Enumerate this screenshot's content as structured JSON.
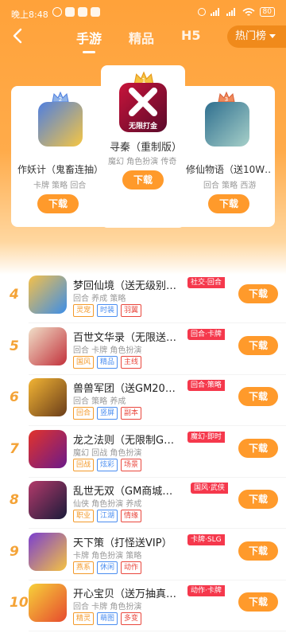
{
  "status_bar": {
    "time": "晚上8:48",
    "battery": "80"
  },
  "nav": {
    "tabs": [
      {
        "label": "手游",
        "active": true
      },
      {
        "label": "精品",
        "active": false
      },
      {
        "label": "H5",
        "active": false
      }
    ],
    "hot_button": "热门榜"
  },
  "podium": [
    {
      "rank": 2,
      "title": "作妖计（鬼畜连抽）",
      "tags": "卡牌 策略 回合",
      "button": "下载",
      "icon_colors": [
        "#4f7fe0",
        "#f6c642"
      ]
    },
    {
      "rank": 1,
      "title": "寻秦（重制版）",
      "tags": "魔幻 角色扮演 传奇",
      "button": "下载",
      "icon_label": "无限打金",
      "icon_colors": [
        "#c8143b",
        "#5a0a2a"
      ]
    },
    {
      "rank": 3,
      "title": "修仙物语（送10W…",
      "tags": "回合 策略 西游",
      "button": "下载",
      "icon_colors": [
        "#2f6f8f",
        "#a7d0c9"
      ]
    }
  ],
  "list": [
    {
      "rank": "4",
      "name": "梦回仙境（送无级别光…",
      "category": "社交·回合",
      "tags": "回合 养成 策略",
      "chips": [
        {
          "t": "灵宠",
          "c": "#f39a2b"
        },
        {
          "t": "时装",
          "c": "#4a8df0"
        },
        {
          "t": "羽翼",
          "c": "#e9473d"
        }
      ],
      "icon_colors": [
        "#f5c04a",
        "#3c8ee8"
      ]
    },
    {
      "rank": "5",
      "name": "百世文华录（无限送充…",
      "category": "回合·卡牌",
      "tags": "回合 卡牌 角色扮演",
      "chips": [
        {
          "t": "国风",
          "c": "#f39a2b"
        },
        {
          "t": "精品",
          "c": "#4a8df0"
        },
        {
          "t": "主线",
          "c": "#e9473d"
        }
      ],
      "icon_colors": [
        "#f0dfc8",
        "#c2313b"
      ]
    },
    {
      "rank": "6",
      "name": "兽兽军团（送GM20万…",
      "category": "回合·策略",
      "tags": "回合 策略 养成",
      "chips": [
        {
          "t": "回合",
          "c": "#f39a2b"
        },
        {
          "t": "竖屏",
          "c": "#4a8df0"
        },
        {
          "t": "副本",
          "c": "#e9473d"
        }
      ],
      "icon_colors": [
        "#f2b434",
        "#6a3d1a"
      ]
    },
    {
      "rank": "7",
      "name": "龙之法则（无限制GM…",
      "category": "魔幻·即时",
      "tags": "魔幻 回战 角色扮演",
      "chips": [
        {
          "t": "回战",
          "c": "#f39a2b"
        },
        {
          "t": "炫彩",
          "c": "#4a8df0"
        },
        {
          "t": "场景",
          "c": "#e9473d"
        }
      ],
      "icon_colors": [
        "#e2332b",
        "#6b1a8a"
      ]
    },
    {
      "rank": "8",
      "name": "乱世无双（GM商城版）",
      "category": "国风·武侠",
      "tags": "仙侠 角色扮演 养成",
      "chips": [
        {
          "t": "职业",
          "c": "#f39a2b"
        },
        {
          "t": "江湖",
          "c": "#4a8df0"
        },
        {
          "t": "情缘",
          "c": "#e9473d"
        }
      ],
      "icon_colors": [
        "#b23a6a",
        "#1b1b3a"
      ]
    },
    {
      "rank": "9",
      "name": "天下策（打怪送VIP）",
      "category": "卡牌·SLG",
      "tags": "卡牌 角色扮演 策略",
      "chips": [
        {
          "t": "燕系",
          "c": "#f39a2b"
        },
        {
          "t": "休闲",
          "c": "#4a8df0"
        },
        {
          "t": "动作",
          "c": "#e9473d"
        }
      ],
      "icon_colors": [
        "#7a3fd0",
        "#f5c342"
      ]
    },
    {
      "rank": "10",
      "name": "开心宝贝（送万抽真充）",
      "category": "动作·卡牌",
      "tags": "回合 卡牌 角色扮演",
      "chips": [
        {
          "t": "精灵",
          "c": "#f39a2b"
        },
        {
          "t": "萌图",
          "c": "#4a8df0"
        },
        {
          "t": "多变",
          "c": "#e9473d"
        }
      ],
      "icon_colors": [
        "#f7d13a",
        "#e64a2e"
      ]
    }
  ]
}
